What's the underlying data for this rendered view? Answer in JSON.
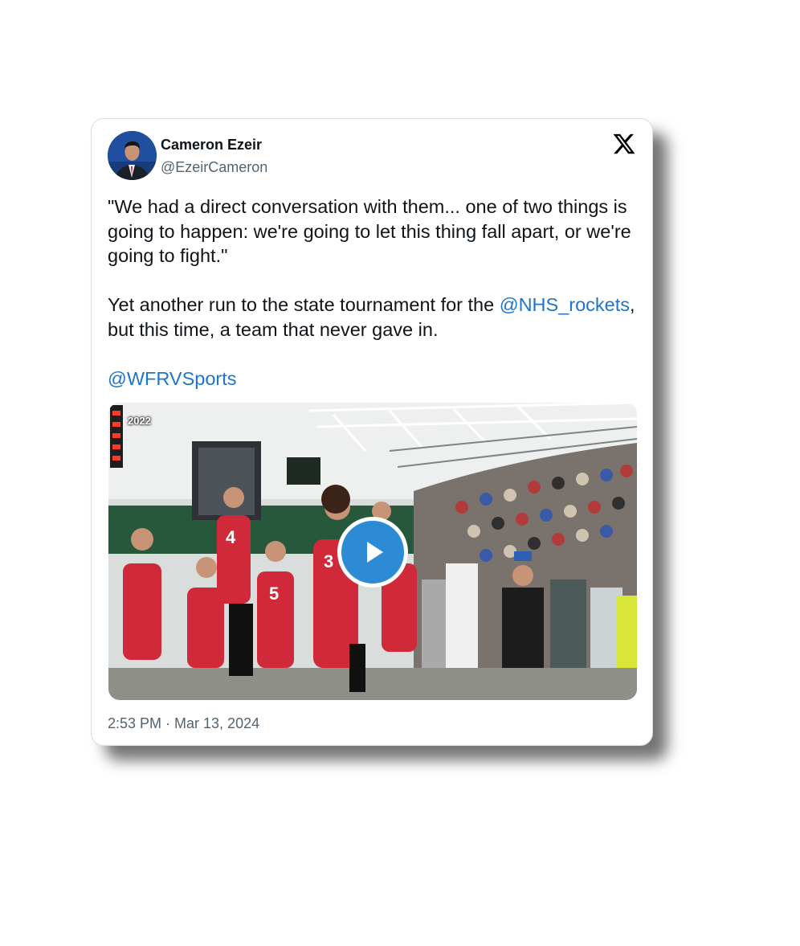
{
  "tweet": {
    "author_name": "Cameron Ezeir",
    "author_handle": "@EzeirCameron",
    "text_part1": "\"We had a direct conversation with them... one of two things is going to happen: we're going to let this thing fall apart, or we're going to fight.\"\n\nYet another run to the state tournament for the ",
    "mention1": "@NHS_rockets",
    "text_part2": ", but this time, a team that never gave in.\n\n",
    "mention2": "@WFRVSports",
    "timestamp": "2:53 PM · Mar 13, 2024"
  },
  "media": {
    "type": "video",
    "year_overlay": "2022",
    "play_icon": "play-icon",
    "play_color": "#2d8bd6"
  },
  "icons": {
    "brand": "x-logo-icon"
  },
  "colors": {
    "link": "#1d75c9",
    "secondary_text": "#536471"
  }
}
